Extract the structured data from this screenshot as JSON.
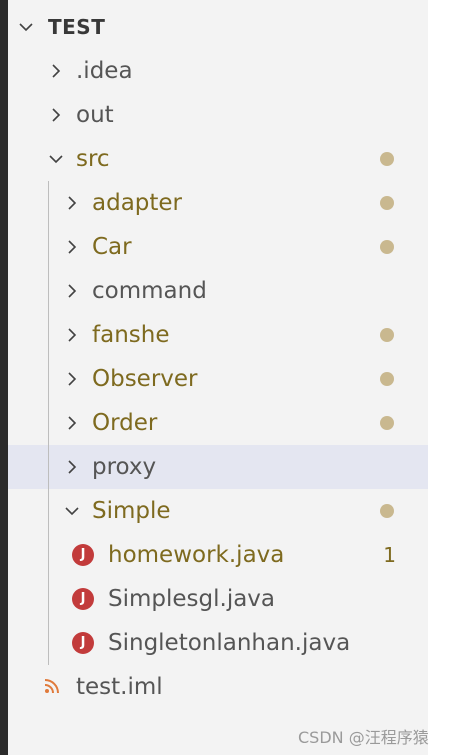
{
  "colors": {
    "modified": "#7e6a1f",
    "normal": "#555555",
    "header": "#383838",
    "dot": "#c9b88f",
    "hover_bg": "#e4e6f1",
    "java_icon": "#c23b3b",
    "rss_icon": "#e07a3b"
  },
  "explorer": {
    "root": {
      "label": "TEST",
      "icon": "chevron-down-icon"
    },
    "items": [
      {
        "label": ".idea",
        "kind": "folder",
        "expanded": false,
        "depth": 0,
        "modified": false
      },
      {
        "label": "out",
        "kind": "folder",
        "expanded": false,
        "depth": 0,
        "modified": false
      },
      {
        "label": "src",
        "kind": "folder",
        "expanded": true,
        "depth": 0,
        "modified": true,
        "dot": true
      },
      {
        "label": "adapter",
        "kind": "folder",
        "expanded": false,
        "depth": 1,
        "modified": true,
        "dot": true
      },
      {
        "label": "Car",
        "kind": "folder",
        "expanded": false,
        "depth": 1,
        "modified": true,
        "dot": true
      },
      {
        "label": "command",
        "kind": "folder",
        "expanded": false,
        "depth": 1,
        "modified": false
      },
      {
        "label": "fanshe",
        "kind": "folder",
        "expanded": false,
        "depth": 1,
        "modified": true,
        "dot": true
      },
      {
        "label": "Observer",
        "kind": "folder",
        "expanded": false,
        "depth": 1,
        "modified": true,
        "dot": true
      },
      {
        "label": "Order",
        "kind": "folder",
        "expanded": false,
        "depth": 1,
        "modified": true,
        "dot": true
      },
      {
        "label": "proxy",
        "kind": "folder",
        "expanded": false,
        "depth": 1,
        "modified": false,
        "hover": true
      },
      {
        "label": "Simple",
        "kind": "folder",
        "expanded": true,
        "depth": 1,
        "modified": true,
        "dot": true
      },
      {
        "label": "homework.java",
        "kind": "java",
        "depth": 2,
        "modified": true,
        "count": "1",
        "icon_letter": "J"
      },
      {
        "label": "Simplesgl.java",
        "kind": "java",
        "depth": 2,
        "modified": false,
        "icon_letter": "J"
      },
      {
        "label": "Singletonlanhan.java",
        "kind": "java",
        "depth": 2,
        "modified": false,
        "icon_letter": "J"
      },
      {
        "label": "test.iml",
        "kind": "rss",
        "depth": 0,
        "modified": false
      }
    ]
  },
  "watermark": "CSDN @汪程序猿"
}
